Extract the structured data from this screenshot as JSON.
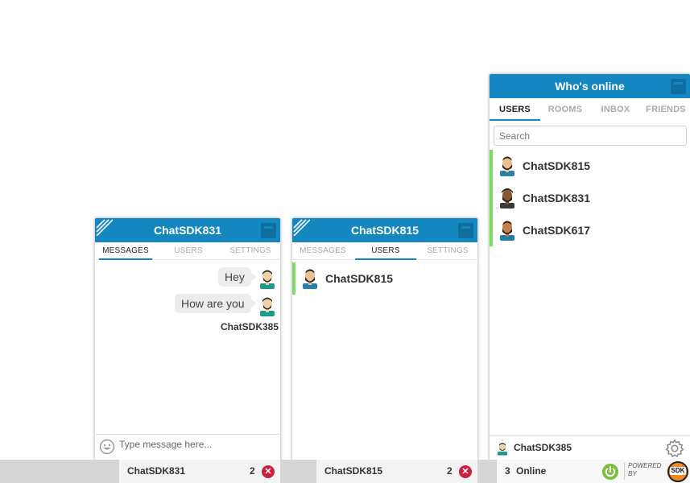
{
  "colors": {
    "header": "#1487c0",
    "online_bar": "#7ddc64",
    "close": "#cc1f3d",
    "power": "#7bbf3a"
  },
  "win1": {
    "title": "ChatSDK831",
    "tabs": [
      "MESSAGES",
      "USERS",
      "SETTINGS"
    ],
    "messages": [
      {
        "text": "Hey"
      },
      {
        "text": "How are you"
      }
    ],
    "sender": "ChatSDK385",
    "compose_placeholder": "Type message here..."
  },
  "win2": {
    "title": "ChatSDK815",
    "tabs": [
      "MESSAGES",
      "USERS",
      "SETTINGS"
    ],
    "users": [
      "ChatSDK815"
    ]
  },
  "online": {
    "title": "Who's online",
    "tabs": [
      "USERS",
      "ROOMS",
      "INBOX",
      "FRIENDS"
    ],
    "search_placeholder": "Search",
    "users": [
      "ChatSDK815",
      "ChatSDK831",
      "ChatSDK617"
    ],
    "current_user": "ChatSDK385"
  },
  "bottom": {
    "tab1": {
      "name": "ChatSDK831",
      "count": "2"
    },
    "tab2": {
      "name": "ChatSDK815",
      "count": "2"
    },
    "online_count": "3",
    "online_label": "Online",
    "powered_by": [
      "POWERED",
      "BY"
    ],
    "logo": "SDK"
  },
  "icons": {
    "minimize": "minimize-icon",
    "close": "close-icon",
    "smiley": "smiley-icon",
    "gear": "gear-icon",
    "power": "power-icon",
    "resize": "resize-stripes-icon"
  }
}
